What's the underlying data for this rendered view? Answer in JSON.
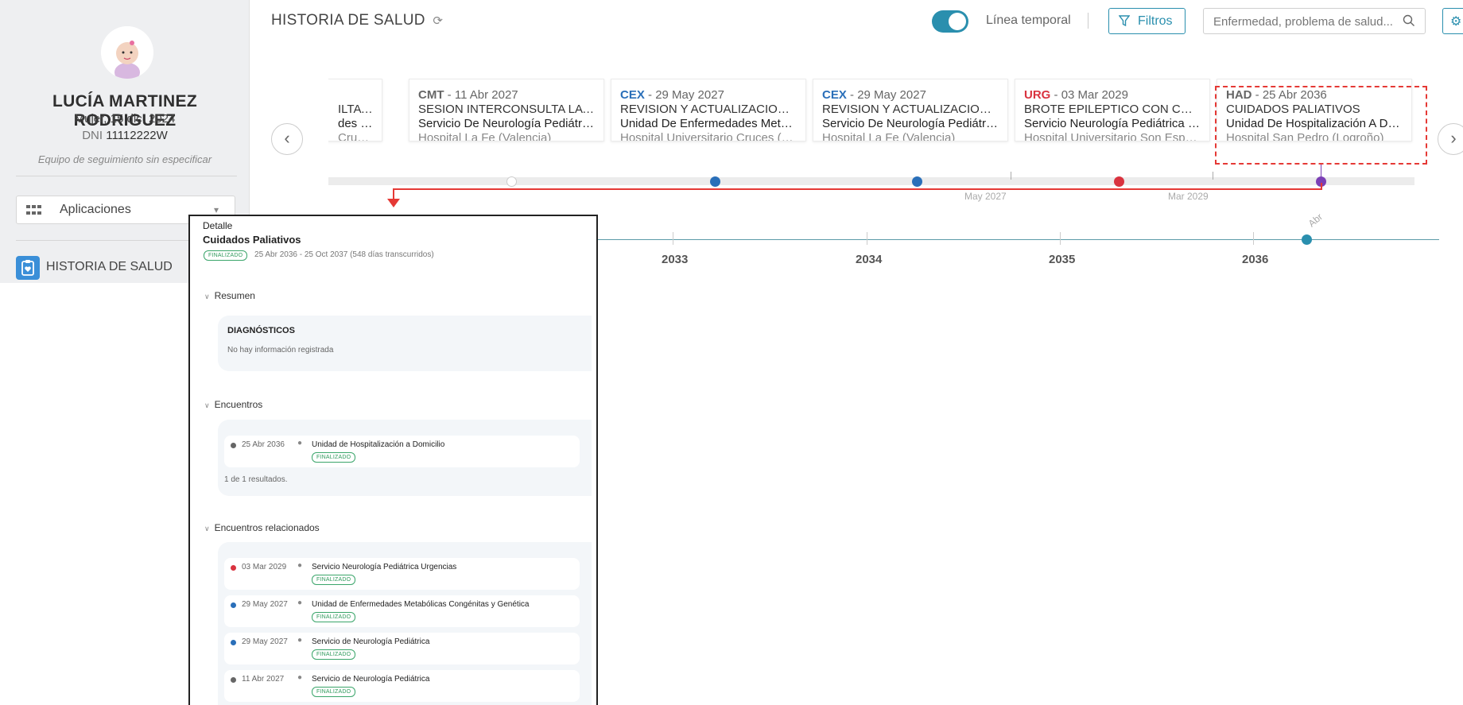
{
  "patient": {
    "name": "LUCÍA MARTINEZ RODRIGUEZ",
    "gender_dob": "Mujer, 15 dic. 2024",
    "dni_label": "DNI",
    "dni": "11112222W",
    "team": "Equipo de seguimiento sin especificar"
  },
  "sidebar": {
    "apps_label": "Aplicaciones",
    "nav_item": "HISTORIA DE SALUD"
  },
  "header": {
    "title": "HISTORIA DE SALUD",
    "toggle_label": "Línea temporal",
    "toggle_on": true,
    "filters_label": "Filtros",
    "search_placeholder": "Enfermedad, problema de salud..."
  },
  "timeline": {
    "events": [
      {
        "type": "",
        "date": "",
        "title": "ILTA CRUC...",
        "service": "des Metab...",
        "hospital": "Cruces (Bi..."
      },
      {
        "type": "CMT",
        "date": "11 Abr 2027",
        "title": "SESION INTERCONSULTA LA FE...",
        "service": "Servicio De Neurología Pediátrica",
        "hospital": "Hospital La Fe (Valencia)"
      },
      {
        "type": "CEX",
        "date": "29 May 2027",
        "title": "REVISION Y ACTUALIZACION EL...",
        "service": "Unidad De Enfermedades Metab...",
        "hospital": "Hospital Universitario Cruces (Bi..."
      },
      {
        "type": "CEX",
        "date": "29 May 2027",
        "title": "REVISION Y ACTUALIZACION EL...",
        "service": "Servicio De Neurología Pediátrica",
        "hospital": "Hospital La Fe (Valencia)"
      },
      {
        "type": "URG",
        "date": "03 Mar 2029",
        "title": "BROTE EPILEPTICO CON CRISIS...",
        "service": "Servicio Neurología Pediátrica U...",
        "hospital": "Hospital Universitario Son Espa..."
      },
      {
        "type": "HAD",
        "date": "25 Abr 2036",
        "title": "CUIDADOS PALIATIVOS",
        "service": "Unidad De Hospitalización A Do...",
        "hospital": "Hospital San Pedro (Logroño)"
      }
    ],
    "track_labels": [
      "May 2027",
      "Mar 2029"
    ],
    "years": [
      "2033",
      "2034",
      "2035",
      "2036"
    ],
    "marker_label": "Abr",
    "colors": {
      "CEX": "#2a6fb9",
      "URG": "#d9333f",
      "HAD": "#7b3fb5",
      "CMT": "#666666"
    }
  },
  "detail": {
    "header": "Detalle",
    "title": "Cuidados Paliativos",
    "status": "FINALIZADO",
    "period": "25 Abr 2036 - 25 Oct 2037 (548 días transcurridos)",
    "sections": {
      "summary": "Resumen",
      "diagnoses_title": "DIAGNÓSTICOS",
      "diagnoses_empty": "No hay información registrada",
      "encounters": "Encuentros",
      "related": "Encuentros relacionados"
    },
    "encounters": [
      {
        "date": "25 Abr 2036",
        "name": "Unidad de Hospitalización a Domicilio",
        "status": "FINALIZADO",
        "color": "#666666"
      }
    ],
    "encounters_count": "1 de 1 resultados.",
    "related": [
      {
        "date": "03 Mar 2029",
        "name": "Servicio Neurología Pediátrica Urgencias",
        "status": "FINALIZADO",
        "color": "#d9333f"
      },
      {
        "date": "29 May 2027",
        "name": "Unidad de Enfermedades Metabólicas Congénitas y Genética",
        "status": "FINALIZADO",
        "color": "#2a6fb9"
      },
      {
        "date": "29 May 2027",
        "name": "Servicio de Neurología Pediátrica",
        "status": "FINALIZADO",
        "color": "#2a6fb9"
      },
      {
        "date": "11 Abr 2027",
        "name": "Servicio de Neurología Pediátrica",
        "status": "FINALIZADO",
        "color": "#666666"
      }
    ]
  }
}
